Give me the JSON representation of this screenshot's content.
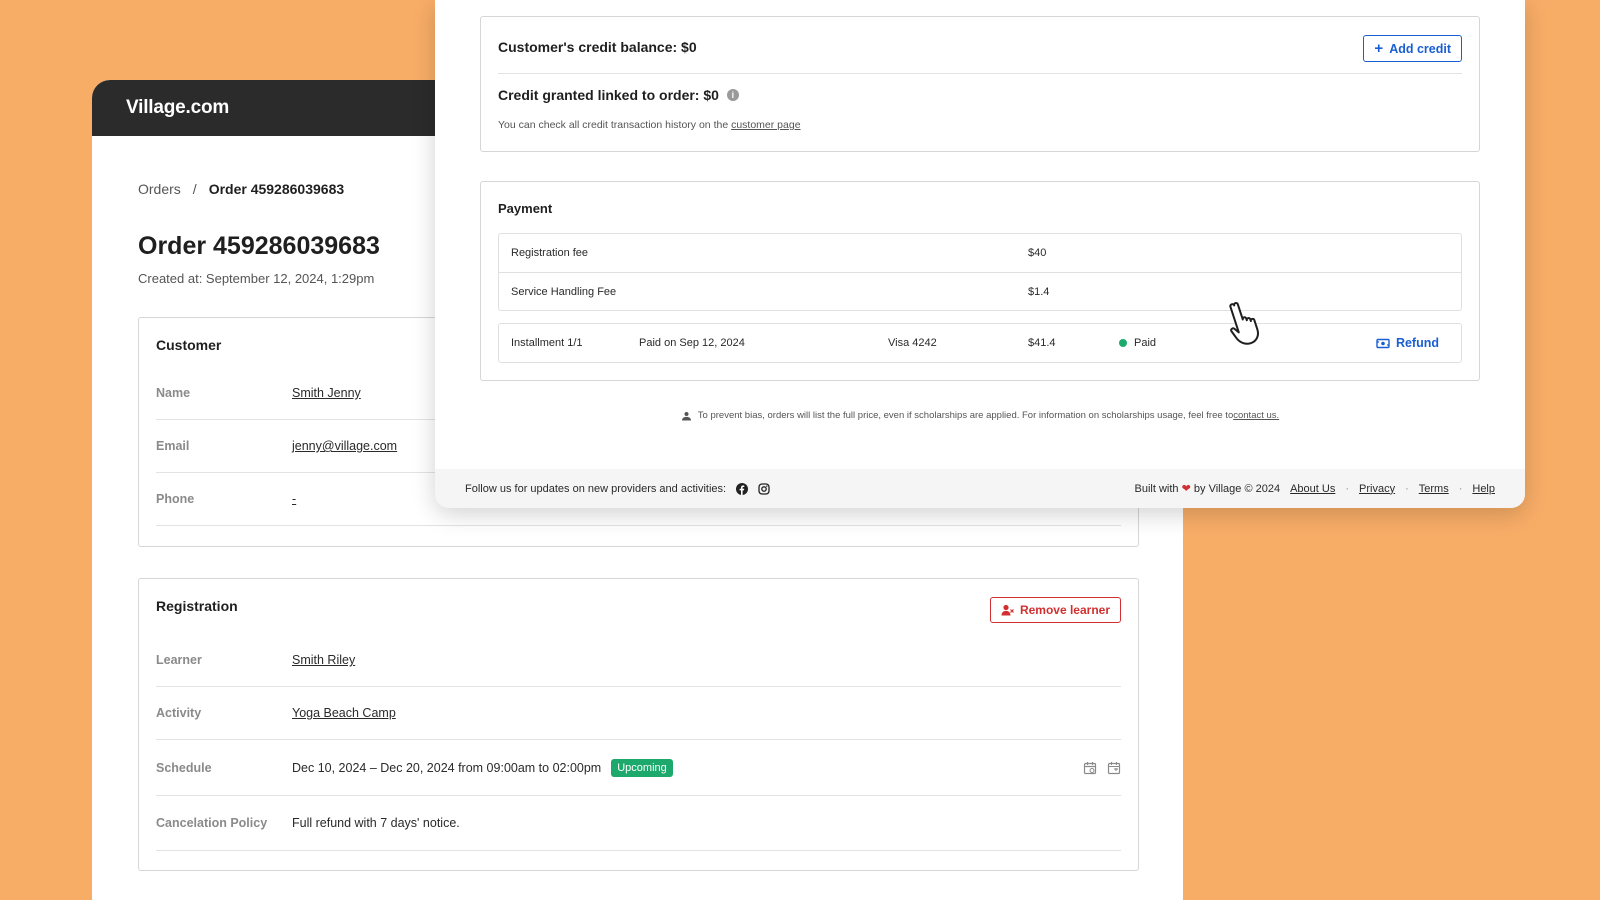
{
  "app": {
    "brand": "Village.com"
  },
  "breadcrumb": {
    "parent": "Orders",
    "separator": "/",
    "current": "Order 459286039683"
  },
  "page": {
    "title": "Order 459286039683",
    "created": "Created at: September 12, 2024, 1:29pm"
  },
  "customer": {
    "title": "Customer",
    "rows": [
      {
        "label": "Name",
        "value": "Smith Jenny"
      },
      {
        "label": "Email",
        "value": "jenny@village.com"
      },
      {
        "label": "Phone",
        "value": "-"
      }
    ]
  },
  "registration": {
    "title": "Registration",
    "remove_label": "Remove learner",
    "learner_label": "Learner",
    "learner_value": "Smith Riley",
    "activity_label": "Activity",
    "activity_value": "Yoga Beach Camp",
    "schedule_label": "Schedule",
    "schedule_value": "Dec 10, 2024 – Dec 20, 2024 from 09:00am to 02:00pm",
    "schedule_badge": "Upcoming",
    "policy_label": "Cancelation Policy",
    "policy_value": "Full refund with 7 days' notice."
  },
  "credit": {
    "balance": "Customer's credit balance: $0",
    "add_label": "Add credit",
    "linked": "Credit granted linked to order: $0",
    "note_prefix": "You can check all credit transaction history on the ",
    "note_link": "customer page"
  },
  "payment": {
    "title": "Payment",
    "fees": [
      {
        "label": "Registration fee",
        "amount": "$40"
      },
      {
        "label": "Service Handling Fee",
        "amount": "$1.4"
      }
    ],
    "installment": {
      "name": "Installment 1/1",
      "paid_on": "Paid on Sep 12, 2024",
      "card": "Visa 4242",
      "amount": "$41.4",
      "status": "Paid",
      "refund_label": "Refund"
    }
  },
  "bias_note": {
    "text": "To prevent bias, orders will list the full price, even if scholarships are applied. For information on scholarships usage, feel free to",
    "link": "contact us."
  },
  "footer": {
    "follow": "Follow us for updates on new providers and activities:",
    "built_prefix": "Built with",
    "built_suffix": "by Village © 2024",
    "links": [
      "About Us",
      "Privacy",
      "Terms",
      "Help"
    ]
  },
  "colors": {
    "background": "#F8AD67",
    "accent_blue": "#1a5fd1",
    "danger": "#d23030",
    "success": "#1ea96c"
  },
  "icons": [
    "plus-icon",
    "info-icon",
    "refund-icon",
    "remove-user-icon",
    "calendar-icon",
    "hand-pointer-icon",
    "facebook-icon",
    "instagram-icon",
    "scholarship-icon"
  ]
}
